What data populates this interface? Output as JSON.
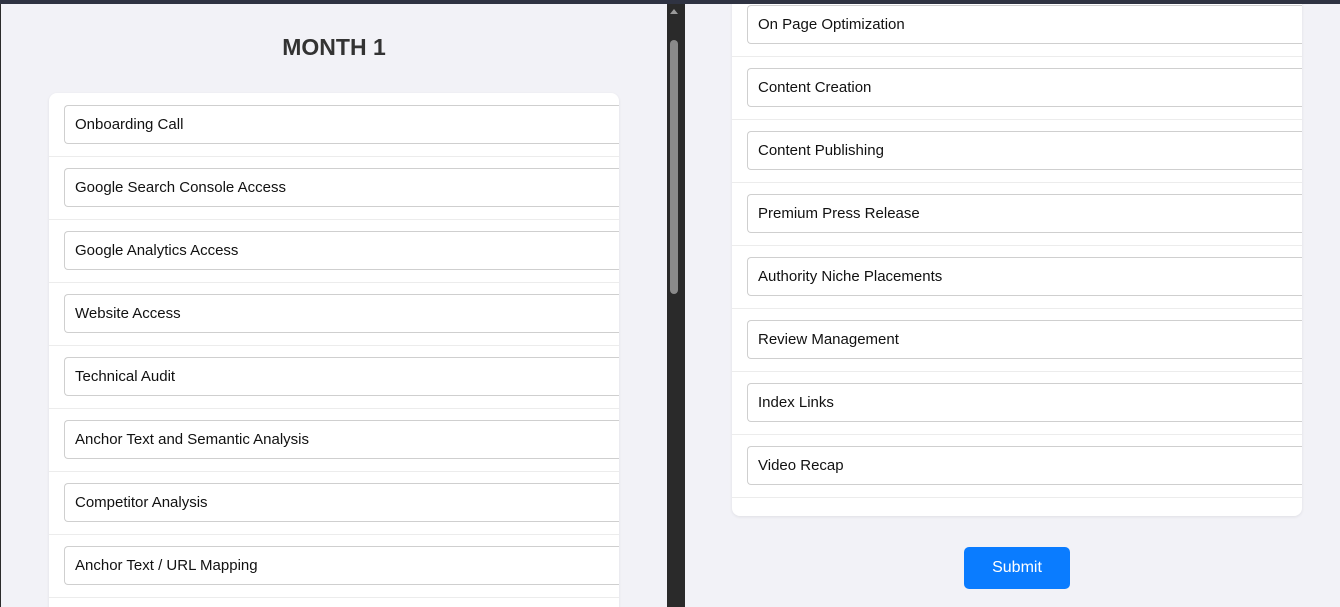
{
  "left_panel": {
    "title": "MONTH 1",
    "items": [
      "Onboarding Call",
      "Google Search Console Access",
      "Google Analytics Access",
      "Website Access",
      "Technical Audit",
      "Anchor Text and Semantic Analysis",
      "Competitor Analysis",
      "Anchor Text / URL Mapping"
    ]
  },
  "right_panel": {
    "items": [
      "On Page Optimization",
      "Content Creation",
      "Content Publishing",
      "Premium Press Release",
      "Authority Niche Placements",
      "Review Management",
      "Index Links",
      "Video Recap"
    ],
    "submit_label": "Submit"
  },
  "colors": {
    "page_background": "#f2f2f7",
    "submit_button": "#0a7cff",
    "divider": "#2a2a2a"
  }
}
